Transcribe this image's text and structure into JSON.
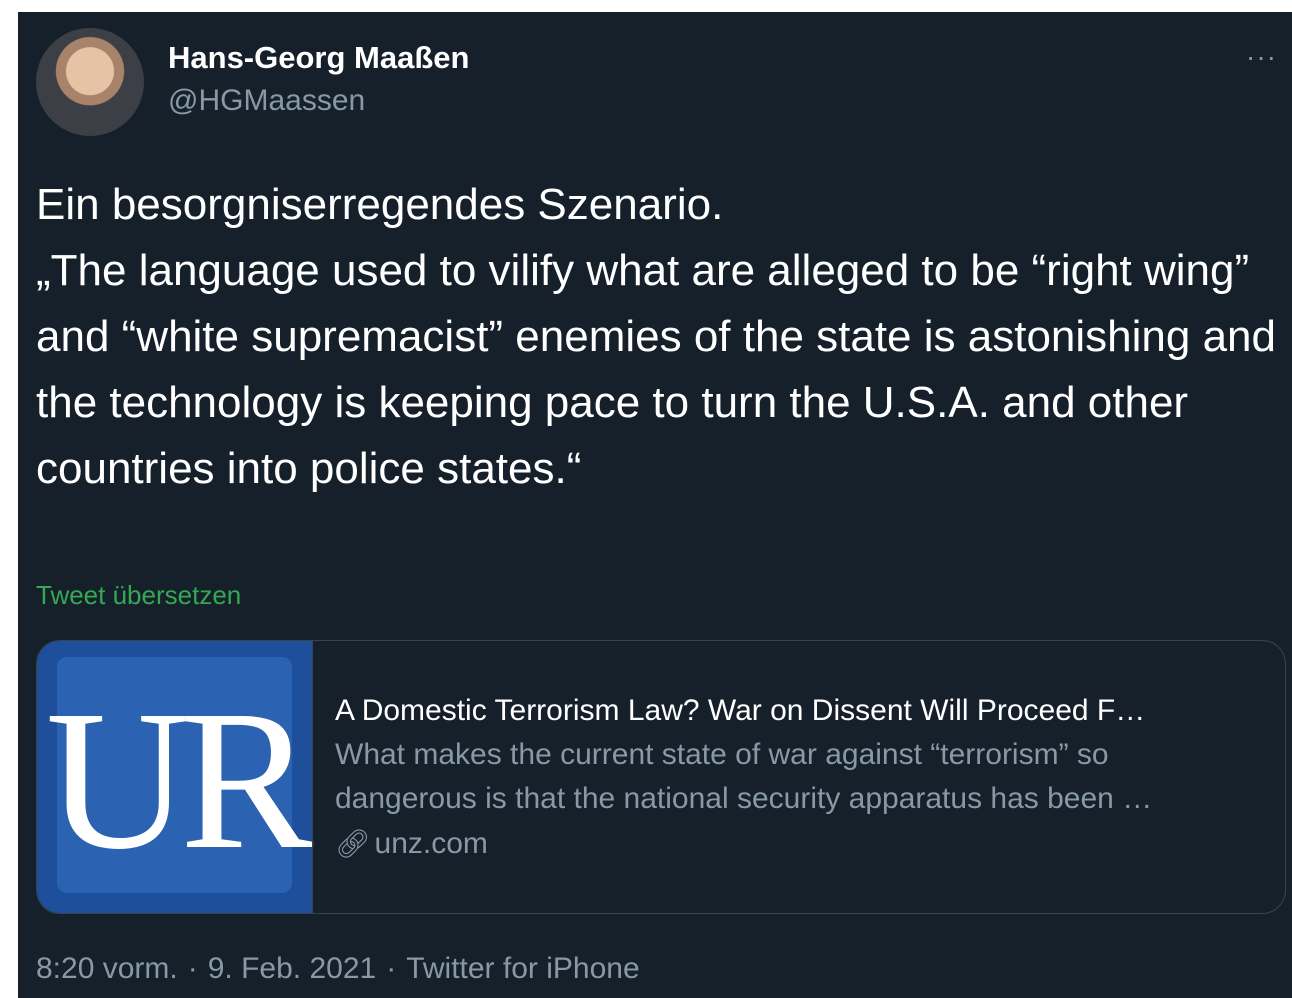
{
  "author": {
    "name": "Hans-Georg Maaßen",
    "handle": "@HGMaassen"
  },
  "more_icon": "···",
  "tweet": {
    "text": "Ein besorgniserregendes Szenario.\n„The language used to vilify what are alleged to be “right wing” and “white supremacist” enemies of the state is astonishing and the technology is keeping pace to turn the U.S.A. and other countries into police states.“",
    "translate_label": "Tweet übersetzen"
  },
  "card": {
    "thumbnail_text": "UR",
    "title": "A Domestic Terrorism Law? War on Dissent Will Proceed F…",
    "description_line1": "What makes the current state of war against “terrorism” so",
    "description_line2": "dangerous is that the national security apparatus has been …",
    "link_icon": "link-icon",
    "domain": "unz.com"
  },
  "meta": {
    "time": "8:20 vorm.",
    "separator": "·",
    "date": "9. Feb. 2021",
    "source": "Twitter for iPhone"
  },
  "colors": {
    "background": "#15202b",
    "text": "#ffffff",
    "secondary": "#8899a6",
    "translate": "#35a853",
    "thumbnail": "#1d4f9a"
  }
}
